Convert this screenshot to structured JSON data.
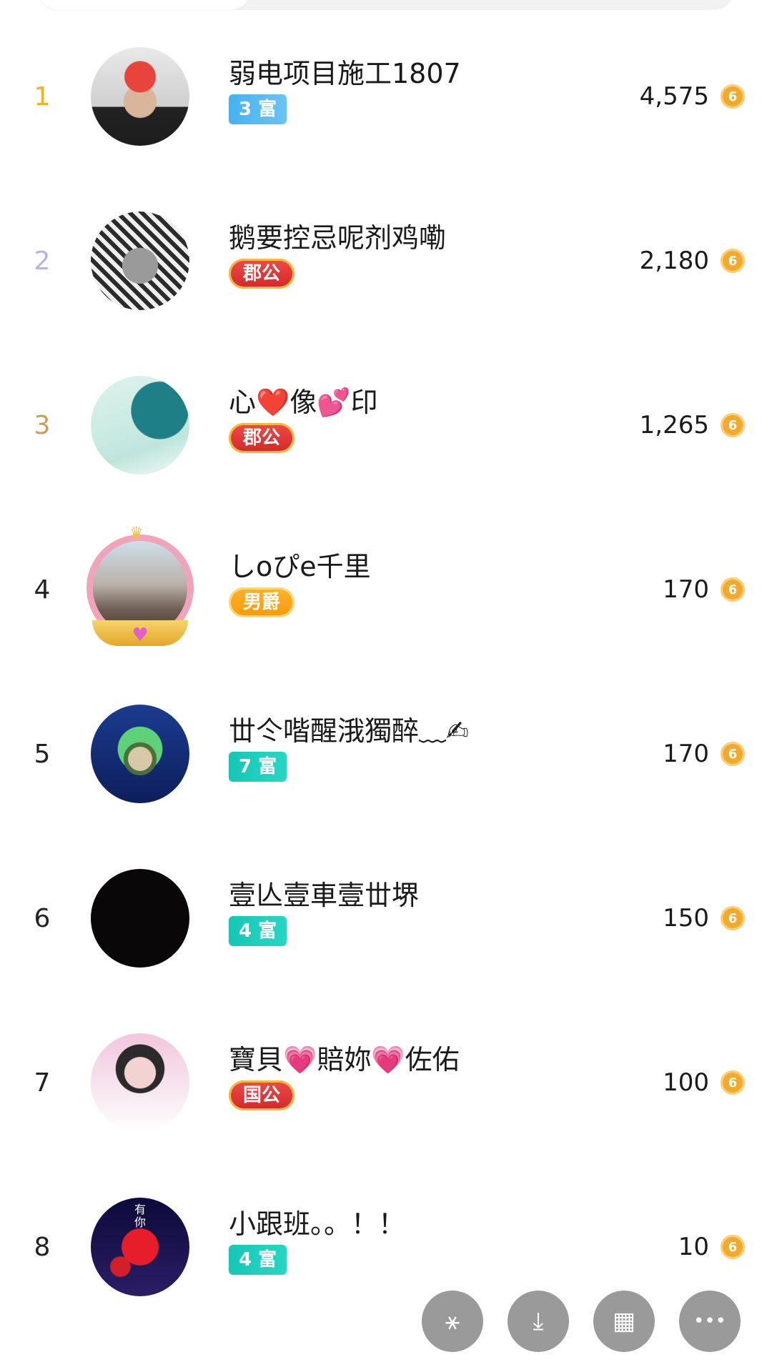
{
  "coin_icon": "coin-icon",
  "colors": {
    "rank1": "#f2b21f",
    "rank2": "#b7b1e8",
    "rank3": "#cc9a5b",
    "coin": "#f3aa2c",
    "fab": "#9a9a9a"
  },
  "rows": [
    {
      "rank": "1",
      "name": "弱电项目施工1807",
      "badge": "3 富",
      "score": "4,575"
    },
    {
      "rank": "2",
      "name": "鹅要控忌呢剂鸡嘞",
      "badge": "郡公",
      "score": "2,180"
    },
    {
      "rank": "3",
      "name": "心❤️像💕印",
      "badge": "郡公",
      "score": "1,265"
    },
    {
      "rank": "4",
      "name": "しoぴe千里",
      "badge": "男爵",
      "score": "170"
    },
    {
      "rank": "5",
      "name": "丗仒喈醒涐獨醉﹏✍",
      "badge": "7 富",
      "score": "170"
    },
    {
      "rank": "6",
      "name": "壹亾壹車壹丗堺",
      "badge": "4 富",
      "score": "150"
    },
    {
      "rank": "7",
      "name": "寶貝💗賠妳💗佐佑",
      "badge": "国公",
      "score": "100"
    },
    {
      "rank": "8",
      "name": "小跟班。。！！",
      "badge": "4 富",
      "score": "10",
      "avatar_text": "有\n你"
    }
  ],
  "toolbar": {
    "buttons": [
      {
        "name": "share-button",
        "icon": "share-icon",
        "glyph": "⚹"
      },
      {
        "name": "save-button",
        "icon": "download-icon",
        "glyph": "⤓"
      },
      {
        "name": "grid-button",
        "icon": "grid-icon",
        "glyph": "▦"
      },
      {
        "name": "more-button",
        "icon": "more-icon",
        "glyph": "•••"
      }
    ]
  }
}
